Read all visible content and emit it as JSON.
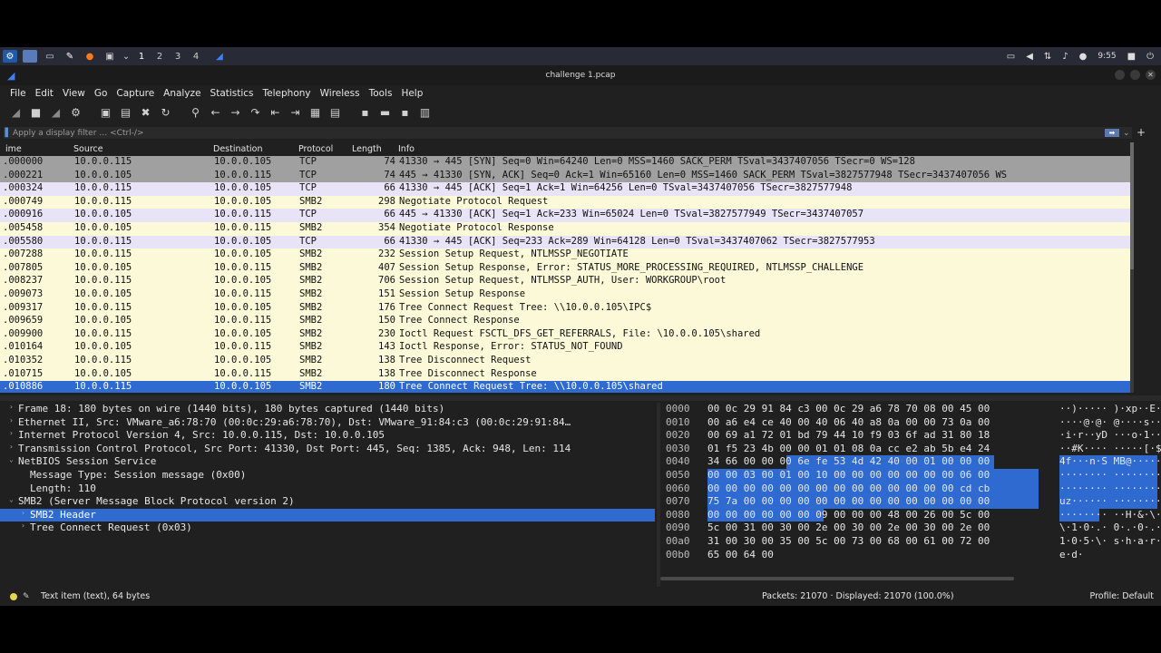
{
  "taskbar": {
    "workspaces": [
      "1",
      "2",
      "3",
      "4"
    ],
    "clock": "9:55"
  },
  "window": {
    "title": "challenge 1.pcap"
  },
  "menu": [
    "File",
    "Edit",
    "View",
    "Go",
    "Capture",
    "Analyze",
    "Statistics",
    "Telephony",
    "Wireless",
    "Tools",
    "Help"
  ],
  "filter": {
    "placeholder": "Apply a display filter … <Ctrl-/>"
  },
  "columns": [
    "ime",
    "Source",
    "Destination",
    "Protocol",
    "Length",
    "Info"
  ],
  "packets": [
    {
      "time": ".000000",
      "src": "10.0.0.115",
      "dst": "10.0.0.105",
      "proto": "TCP",
      "len": "74",
      "info": "41330 → 445 [SYN] Seq=0 Win=64240 Len=0 MSS=1460 SACK_PERM TSval=3437407056 TSecr=0 WS=128",
      "cls": "tcp-syn"
    },
    {
      "time": ".000221",
      "src": "10.0.0.105",
      "dst": "10.0.0.115",
      "proto": "TCP",
      "len": "74",
      "info": "445 → 41330 [SYN, ACK] Seq=0 Ack=1 Win=65160 Len=0 MSS=1460 SACK_PERM TSval=3827577948 TSecr=3437407056 WS",
      "cls": "tcp-syn"
    },
    {
      "time": ".000324",
      "src": "10.0.0.115",
      "dst": "10.0.0.105",
      "proto": "TCP",
      "len": "66",
      "info": "41330 → 445 [ACK] Seq=1 Ack=1 Win=64256 Len=0 TSval=3437407056 TSecr=3827577948",
      "cls": "tcp"
    },
    {
      "time": ".000749",
      "src": "10.0.0.115",
      "dst": "10.0.0.105",
      "proto": "SMB2",
      "len": "298",
      "info": "Negotiate Protocol Request",
      "cls": "smb"
    },
    {
      "time": ".000916",
      "src": "10.0.0.105",
      "dst": "10.0.0.115",
      "proto": "TCP",
      "len": "66",
      "info": "445 → 41330 [ACK] Seq=1 Ack=233 Win=65024 Len=0 TSval=3827577949 TSecr=3437407057",
      "cls": "tcp"
    },
    {
      "time": ".005458",
      "src": "10.0.0.105",
      "dst": "10.0.0.115",
      "proto": "SMB2",
      "len": "354",
      "info": "Negotiate Protocol Response",
      "cls": "smb"
    },
    {
      "time": ".005580",
      "src": "10.0.0.115",
      "dst": "10.0.0.105",
      "proto": "TCP",
      "len": "66",
      "info": "41330 → 445 [ACK] Seq=233 Ack=289 Win=64128 Len=0 TSval=3437407062 TSecr=3827577953",
      "cls": "tcp"
    },
    {
      "time": ".007288",
      "src": "10.0.0.115",
      "dst": "10.0.0.105",
      "proto": "SMB2",
      "len": "232",
      "info": "Session Setup Request, NTLMSSP_NEGOTIATE",
      "cls": "smb"
    },
    {
      "time": ".007805",
      "src": "10.0.0.105",
      "dst": "10.0.0.115",
      "proto": "SMB2",
      "len": "407",
      "info": "Session Setup Response, Error: STATUS_MORE_PROCESSING_REQUIRED, NTLMSSP_CHALLENGE",
      "cls": "smb"
    },
    {
      "time": ".008237",
      "src": "10.0.0.115",
      "dst": "10.0.0.105",
      "proto": "SMB2",
      "len": "706",
      "info": "Session Setup Request, NTLMSSP_AUTH, User: WORKGROUP\\root",
      "cls": "smb"
    },
    {
      "time": ".009073",
      "src": "10.0.0.105",
      "dst": "10.0.0.115",
      "proto": "SMB2",
      "len": "151",
      "info": "Session Setup Response",
      "cls": "smb"
    },
    {
      "time": ".009317",
      "src": "10.0.0.115",
      "dst": "10.0.0.105",
      "proto": "SMB2",
      "len": "176",
      "info": "Tree Connect Request Tree: \\\\10.0.0.105\\IPC$",
      "cls": "smb"
    },
    {
      "time": ".009659",
      "src": "10.0.0.105",
      "dst": "10.0.0.115",
      "proto": "SMB2",
      "len": "150",
      "info": "Tree Connect Response",
      "cls": "smb"
    },
    {
      "time": ".009900",
      "src": "10.0.0.115",
      "dst": "10.0.0.105",
      "proto": "SMB2",
      "len": "230",
      "info": "Ioctl Request FSCTL_DFS_GET_REFERRALS, File: \\10.0.0.105\\shared",
      "cls": "smb"
    },
    {
      "time": ".010164",
      "src": "10.0.0.105",
      "dst": "10.0.0.115",
      "proto": "SMB2",
      "len": "143",
      "info": "Ioctl Response, Error: STATUS_NOT_FOUND",
      "cls": "smb"
    },
    {
      "time": ".010352",
      "src": "10.0.0.115",
      "dst": "10.0.0.105",
      "proto": "SMB2",
      "len": "138",
      "info": "Tree Disconnect Request",
      "cls": "smb"
    },
    {
      "time": ".010715",
      "src": "10.0.0.105",
      "dst": "10.0.0.115",
      "proto": "SMB2",
      "len": "138",
      "info": "Tree Disconnect Response",
      "cls": "smb"
    },
    {
      "time": ".010886",
      "src": "10.0.0.115",
      "dst": "10.0.0.105",
      "proto": "SMB2",
      "len": "180",
      "info": "Tree Connect Request Tree: \\\\10.0.0.105\\shared",
      "cls": "sel"
    }
  ],
  "details": [
    {
      "tw": "›",
      "text": "Frame 18: 180 bytes on wire (1440 bits), 180 bytes captured (1440 bits)",
      "indent": 0
    },
    {
      "tw": "›",
      "text": "Ethernet II, Src: VMware_a6:78:70 (00:0c:29:a6:78:70), Dst: VMware_91:84:c3 (00:0c:29:91:84…",
      "indent": 0
    },
    {
      "tw": "›",
      "text": "Internet Protocol Version 4, Src: 10.0.0.115, Dst: 10.0.0.105",
      "indent": 0
    },
    {
      "tw": "›",
      "text": "Transmission Control Protocol, Src Port: 41330, Dst Port: 445, Seq: 1385, Ack: 948, Len: 114",
      "indent": 0
    },
    {
      "tw": "⌄",
      "text": "NetBIOS Session Service",
      "indent": 0
    },
    {
      "tw": "",
      "text": "Message Type: Session message (0x00)",
      "indent": 1
    },
    {
      "tw": "",
      "text": "Length: 110",
      "indent": 1
    },
    {
      "tw": "⌄",
      "text": "SMB2 (Server Message Block Protocol version 2)",
      "indent": 0
    },
    {
      "tw": "›",
      "text": "SMB2 Header",
      "indent": 1,
      "sel": true
    },
    {
      "tw": "›",
      "text": "Tree Connect Request (0x03)",
      "indent": 1
    }
  ],
  "hex": [
    {
      "off": "0000",
      "bytes": "00 0c 29 91 84 c3 00 0c  29 a6 78 70 08 00 45 00",
      "ascii": "··)·····  )·xp··E·"
    },
    {
      "off": "0010",
      "bytes": "00 a6 e4 ce 40 00 40 06  40 a8 0a 00 00 73 0a 00",
      "ascii": "····@·@·  @····s··"
    },
    {
      "off": "0020",
      "bytes": "00 69 a1 72 01 bd 79 44  10 f9 03 6f ad 31 80 18",
      "ascii": "·i·r··yD  ···o·1··"
    },
    {
      "off": "0030",
      "bytes": "01 f5 23 4b 00 00 01 01  08 0a cc e2 ab 5b e4 24",
      "ascii": "··#K····  ·····[·$"
    },
    {
      "off": "0040",
      "bytes": "34 66 00 00 00 6e fe 53  4d 42 40 00 01 00 00 00",
      "ascii": "4f···n·S  MB@·····"
    },
    {
      "off": "0050",
      "bytes": "00 00 03 00 01 00 10 00  00 00 00 00 00 00 06 00",
      "ascii": "········  ········"
    },
    {
      "off": "0060",
      "bytes": "00 00 00 00 00 00 00 00  00 00 00 00 00 00 cd cb",
      "ascii": "········  ········"
    },
    {
      "off": "0070",
      "bytes": "75 7a 00 00 00 00 00 00  00 00 00 00 00 00 00 00",
      "ascii": "uz······  ········"
    },
    {
      "off": "0080",
      "bytes": "00 00 00 00 00 00 09 00  00 00 48 00 26 00 5c 00",
      "ascii": "········  ··H·&·\\·"
    },
    {
      "off": "0090",
      "bytes": "5c 00 31 00 30 00 2e 00  30 00 2e 00 30 00 2e 00",
      "ascii": "\\·1·0·.·  0·.·0·.·"
    },
    {
      "off": "00a0",
      "bytes": "31 00 30 00 35 00 5c 00  73 00 68 00 61 00 72 00",
      "ascii": "1·0·5·\\·  s·h·a·r·"
    },
    {
      "off": "00b0",
      "bytes": "65 00 64 00",
      "ascii": "e·d·"
    }
  ],
  "status": {
    "left": "Text item (text), 64 bytes",
    "packets": "Packets: 21070 · Displayed: 21070 (100.0%)",
    "profile": "Profile: Default"
  },
  "colors": {
    "selected": "#2e6ad0",
    "smb_row": "#fbf9d8",
    "tcp_row": "#e8e3f6",
    "syn_row": "#a0a0a0"
  }
}
